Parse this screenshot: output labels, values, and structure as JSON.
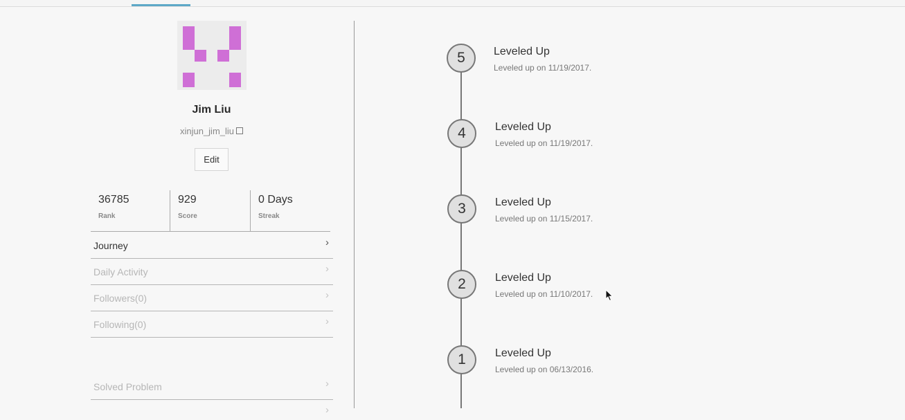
{
  "profile": {
    "name": "Jim Liu",
    "username": "xinjun_jim_liu",
    "edit_label": "Edit"
  },
  "stats": [
    {
      "value": "36785",
      "label": "Rank"
    },
    {
      "value": "929",
      "label": "Score"
    },
    {
      "value": "0 Days",
      "label": "Streak"
    }
  ],
  "menu": {
    "items": [
      {
        "label": "Journey"
      },
      {
        "label": "Daily Activity"
      },
      {
        "label": "Followers(0)"
      },
      {
        "label": "Following(0)"
      }
    ],
    "solved": {
      "label": "Solved Problem"
    }
  },
  "timeline": {
    "events": [
      {
        "level": "5",
        "title": "Leveled Up",
        "detail": "Leveled up on 11/19/2017."
      },
      {
        "level": "4",
        "title": "Leveled Up",
        "detail": "Leveled up on 11/19/2017."
      },
      {
        "level": "3",
        "title": "Leveled Up",
        "detail": "Leveled up on 11/15/2017."
      },
      {
        "level": "2",
        "title": "Leveled Up",
        "detail": "Leveled up on 11/10/2017."
      },
      {
        "level": "1",
        "title": "Leveled Up",
        "detail": "Leveled up on 06/13/2016."
      }
    ]
  },
  "colors": {
    "avatar_fill": "#cf6fd6",
    "active_tab": "#5da8c7"
  }
}
